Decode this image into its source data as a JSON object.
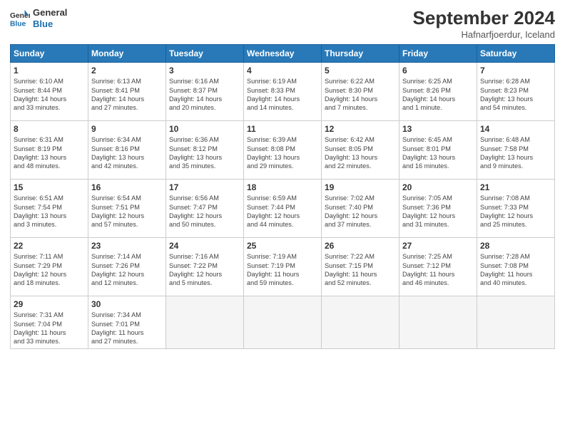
{
  "header": {
    "logo_line1": "General",
    "logo_line2": "Blue",
    "month": "September 2024",
    "location": "Hafnarfjoerdur, Iceland"
  },
  "days_of_week": [
    "Sunday",
    "Monday",
    "Tuesday",
    "Wednesday",
    "Thursday",
    "Friday",
    "Saturday"
  ],
  "weeks": [
    [
      {
        "day": "1",
        "info": "Sunrise: 6:10 AM\nSunset: 8:44 PM\nDaylight: 14 hours\nand 33 minutes."
      },
      {
        "day": "2",
        "info": "Sunrise: 6:13 AM\nSunset: 8:41 PM\nDaylight: 14 hours\nand 27 minutes."
      },
      {
        "day": "3",
        "info": "Sunrise: 6:16 AM\nSunset: 8:37 PM\nDaylight: 14 hours\nand 20 minutes."
      },
      {
        "day": "4",
        "info": "Sunrise: 6:19 AM\nSunset: 8:33 PM\nDaylight: 14 hours\nand 14 minutes."
      },
      {
        "day": "5",
        "info": "Sunrise: 6:22 AM\nSunset: 8:30 PM\nDaylight: 14 hours\nand 7 minutes."
      },
      {
        "day": "6",
        "info": "Sunrise: 6:25 AM\nSunset: 8:26 PM\nDaylight: 14 hours\nand 1 minute."
      },
      {
        "day": "7",
        "info": "Sunrise: 6:28 AM\nSunset: 8:23 PM\nDaylight: 13 hours\nand 54 minutes."
      }
    ],
    [
      {
        "day": "8",
        "info": "Sunrise: 6:31 AM\nSunset: 8:19 PM\nDaylight: 13 hours\nand 48 minutes."
      },
      {
        "day": "9",
        "info": "Sunrise: 6:34 AM\nSunset: 8:16 PM\nDaylight: 13 hours\nand 42 minutes."
      },
      {
        "day": "10",
        "info": "Sunrise: 6:36 AM\nSunset: 8:12 PM\nDaylight: 13 hours\nand 35 minutes."
      },
      {
        "day": "11",
        "info": "Sunrise: 6:39 AM\nSunset: 8:08 PM\nDaylight: 13 hours\nand 29 minutes."
      },
      {
        "day": "12",
        "info": "Sunrise: 6:42 AM\nSunset: 8:05 PM\nDaylight: 13 hours\nand 22 minutes."
      },
      {
        "day": "13",
        "info": "Sunrise: 6:45 AM\nSunset: 8:01 PM\nDaylight: 13 hours\nand 16 minutes."
      },
      {
        "day": "14",
        "info": "Sunrise: 6:48 AM\nSunset: 7:58 PM\nDaylight: 13 hours\nand 9 minutes."
      }
    ],
    [
      {
        "day": "15",
        "info": "Sunrise: 6:51 AM\nSunset: 7:54 PM\nDaylight: 13 hours\nand 3 minutes."
      },
      {
        "day": "16",
        "info": "Sunrise: 6:54 AM\nSunset: 7:51 PM\nDaylight: 12 hours\nand 57 minutes."
      },
      {
        "day": "17",
        "info": "Sunrise: 6:56 AM\nSunset: 7:47 PM\nDaylight: 12 hours\nand 50 minutes."
      },
      {
        "day": "18",
        "info": "Sunrise: 6:59 AM\nSunset: 7:44 PM\nDaylight: 12 hours\nand 44 minutes."
      },
      {
        "day": "19",
        "info": "Sunrise: 7:02 AM\nSunset: 7:40 PM\nDaylight: 12 hours\nand 37 minutes."
      },
      {
        "day": "20",
        "info": "Sunrise: 7:05 AM\nSunset: 7:36 PM\nDaylight: 12 hours\nand 31 minutes."
      },
      {
        "day": "21",
        "info": "Sunrise: 7:08 AM\nSunset: 7:33 PM\nDaylight: 12 hours\nand 25 minutes."
      }
    ],
    [
      {
        "day": "22",
        "info": "Sunrise: 7:11 AM\nSunset: 7:29 PM\nDaylight: 12 hours\nand 18 minutes."
      },
      {
        "day": "23",
        "info": "Sunrise: 7:14 AM\nSunset: 7:26 PM\nDaylight: 12 hours\nand 12 minutes."
      },
      {
        "day": "24",
        "info": "Sunrise: 7:16 AM\nSunset: 7:22 PM\nDaylight: 12 hours\nand 5 minutes."
      },
      {
        "day": "25",
        "info": "Sunrise: 7:19 AM\nSunset: 7:19 PM\nDaylight: 11 hours\nand 59 minutes."
      },
      {
        "day": "26",
        "info": "Sunrise: 7:22 AM\nSunset: 7:15 PM\nDaylight: 11 hours\nand 52 minutes."
      },
      {
        "day": "27",
        "info": "Sunrise: 7:25 AM\nSunset: 7:12 PM\nDaylight: 11 hours\nand 46 minutes."
      },
      {
        "day": "28",
        "info": "Sunrise: 7:28 AM\nSunset: 7:08 PM\nDaylight: 11 hours\nand 40 minutes."
      }
    ],
    [
      {
        "day": "29",
        "info": "Sunrise: 7:31 AM\nSunset: 7:04 PM\nDaylight: 11 hours\nand 33 minutes."
      },
      {
        "day": "30",
        "info": "Sunrise: 7:34 AM\nSunset: 7:01 PM\nDaylight: 11 hours\nand 27 minutes."
      },
      {
        "day": "",
        "info": ""
      },
      {
        "day": "",
        "info": ""
      },
      {
        "day": "",
        "info": ""
      },
      {
        "day": "",
        "info": ""
      },
      {
        "day": "",
        "info": ""
      }
    ]
  ]
}
